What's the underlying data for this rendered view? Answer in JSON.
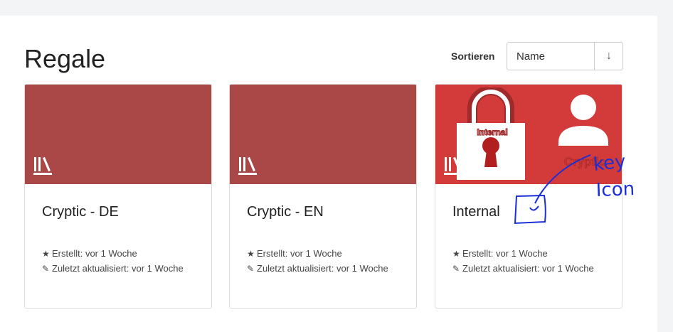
{
  "header": {
    "title": "Regale",
    "sort_label": "Sortieren",
    "sort_value": "Name",
    "sort_dir_symbol": "↓"
  },
  "shelves": [
    {
      "title": "Cryptic - DE",
      "created": "Erstellt: vor 1 Woche",
      "updated": "Zuletzt aktualisiert: vor 1 Woche"
    },
    {
      "title": "Cryptic - EN",
      "created": "Erstellt: vor 1 Woche",
      "updated": "Zuletzt aktualisiert: vor 1 Woche"
    },
    {
      "title": "Internal",
      "created": "Erstellt: vor 1 Woche",
      "updated": "Zuletzt aktualisiert: vor 1 Woche",
      "cover_lock_text": "Internal",
      "cover_user_text": "Cryptic"
    }
  ],
  "annotation": {
    "line1": "key",
    "line2": "Icon"
  },
  "colors": {
    "cover": "#aa4747",
    "cover_internal": "#d33b3b",
    "annotation_ink": "#1a2fd6"
  },
  "icons": [
    "shelf-icon",
    "star-icon",
    "pencil-icon",
    "lock-icon",
    "user-icon",
    "sort-arrow-icon"
  ]
}
